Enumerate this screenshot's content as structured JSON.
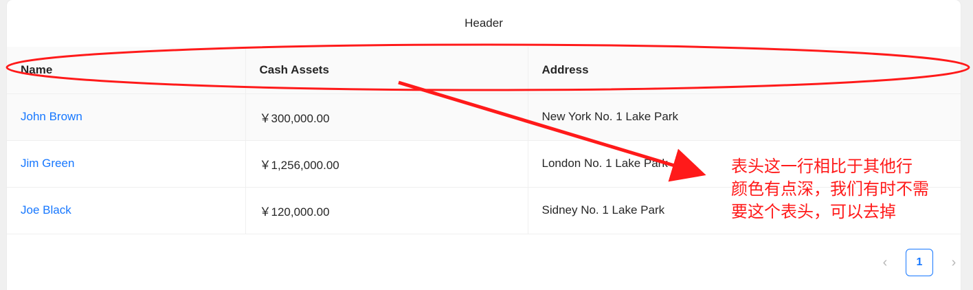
{
  "table": {
    "title": "Header",
    "columns": [
      "Name",
      "Cash Assets",
      "Address"
    ],
    "rows": [
      {
        "name": "John Brown",
        "money": "￥300,000.00",
        "address": "New York No. 1 Lake Park"
      },
      {
        "name": "Jim Green",
        "money": "￥1,256,000.00",
        "address": "London No. 1 Lake Park"
      },
      {
        "name": "Joe Black",
        "money": "￥120,000.00",
        "address": "Sidney No. 1 Lake Park"
      }
    ]
  },
  "pagination": {
    "prev_icon": "‹",
    "current_page": "1",
    "next_icon": "›"
  },
  "annotation": {
    "note_line1": "表头这一行相比于其他行",
    "note_line2": "颜色有点深，我们有时不需",
    "note_line3": "要这个表头，可以去掉",
    "color": "#ff1a1a"
  },
  "colors": {
    "link": "#1677ff",
    "header_bg": "#fafafa",
    "pagination_active": "#1677ff"
  }
}
